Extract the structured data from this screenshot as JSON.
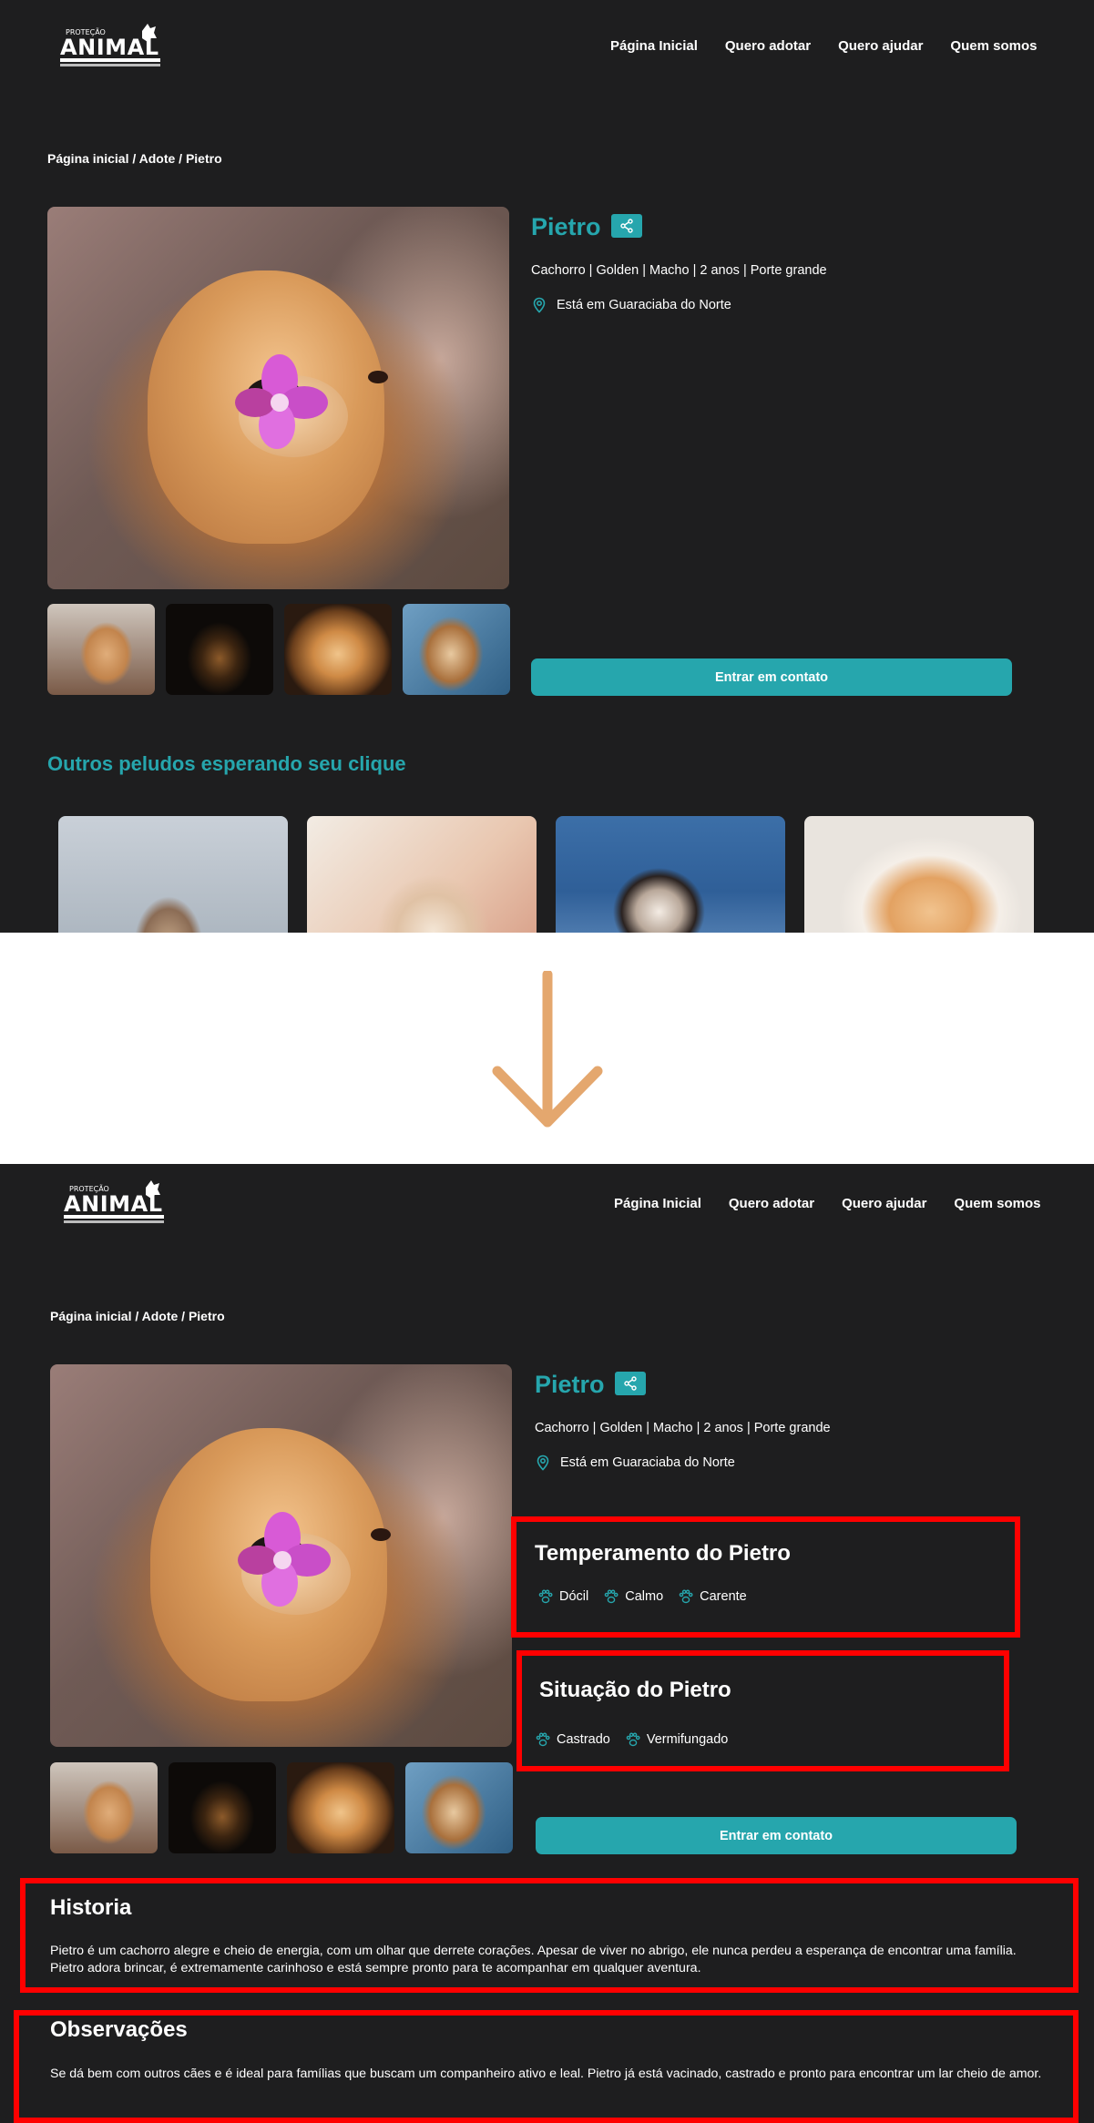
{
  "header": {
    "logo_text": "PROTEÇÃO ANIMAL",
    "nav": [
      "Página Inicial",
      "Quero adotar",
      "Quero ajudar",
      "Quem somos"
    ]
  },
  "breadcrumb": "Página inicial / Adote / Pietro",
  "pet": {
    "name": "Pietro",
    "info": "Cachorro  | Golden | Macho | 2 anos | Porte grande",
    "location": "Está em Guaraciaba do Norte"
  },
  "contact_label": "Entrar em contato",
  "others_title": "Outros peludos esperando seu clique",
  "temperament": {
    "title": "Temperamento do Pietro",
    "items": [
      "Dócil",
      "Calmo",
      "Carente"
    ]
  },
  "situation": {
    "title": "Situação do Pietro",
    "items": [
      "Castrado",
      "Vermifungado"
    ]
  },
  "history": {
    "title": "Historia",
    "text": "Pietro é um cachorro alegre e cheio de energia, com um olhar que derrete corações. Apesar de viver no abrigo, ele nunca perdeu a esperança de encontrar uma família. Pietro adora brincar, é extremamente carinhoso e está sempre pronto para te acompanhar em qualquer aventura."
  },
  "observations": {
    "title": "Observações",
    "text": " Se dá bem com outros cães e é ideal para famílias que buscam um companheiro ativo e leal. Pietro já está vacinado, castrado e pronto para encontrar um lar cheio de amor."
  },
  "colors": {
    "background": "#1e1e1f",
    "accent": "#26a6ad",
    "arrow": "#e4a76e",
    "highlight": "#ff0000"
  },
  "icons": [
    "logo-icon",
    "share-icon",
    "location-pin-icon",
    "paw-icon",
    "arrow-down-icon"
  ]
}
